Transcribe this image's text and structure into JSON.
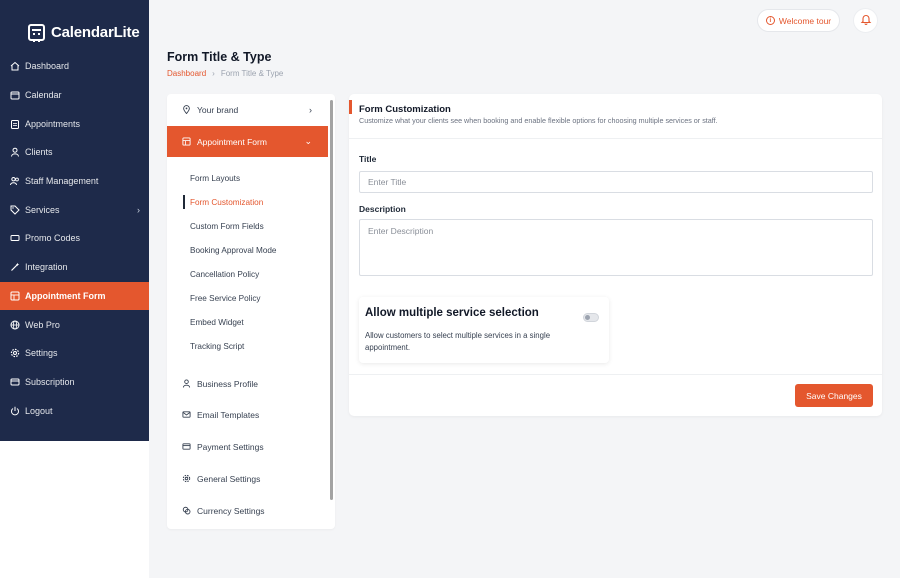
{
  "brand": {
    "name": "CalendarLite"
  },
  "sidebar": {
    "items": [
      {
        "label": "Dashboard",
        "icon": "home-icon"
      },
      {
        "label": "Calendar",
        "icon": "calendar-icon"
      },
      {
        "label": "Appointments",
        "icon": "clipboard-icon"
      },
      {
        "label": "Clients",
        "icon": "user-icon"
      },
      {
        "label": "Staff Management",
        "icon": "users-icon"
      },
      {
        "label": "Services",
        "icon": "tag-icon",
        "has_submenu": true
      },
      {
        "label": "Promo Codes",
        "icon": "ticket-icon"
      },
      {
        "label": "Integration",
        "icon": "wand-icon"
      },
      {
        "label": "Appointment Form",
        "icon": "form-icon",
        "active": true
      },
      {
        "label": "Web Pro",
        "icon": "globe-icon"
      },
      {
        "label": "Settings",
        "icon": "gear-icon"
      },
      {
        "label": "Subscription",
        "icon": "card-icon"
      },
      {
        "label": "Logout",
        "icon": "power-icon"
      }
    ]
  },
  "topbar": {
    "welcome_tour": "Welcome tour"
  },
  "page": {
    "title": "Form Title & Type",
    "breadcrumb": [
      "Dashboard",
      "Form Title & Type"
    ]
  },
  "settings_menu": {
    "your_brand": "Your brand",
    "appointment_form": "Appointment Form",
    "sub_items": [
      "Form Layouts",
      "Form Customization",
      "Custom Form Fields",
      "Booking Approval Mode",
      "Cancellation Policy",
      "Free Service Policy",
      "Embed Widget",
      "Tracking Script"
    ],
    "active_sub": "Form Customization",
    "others": [
      {
        "label": "Business Profile",
        "icon": "person-icon"
      },
      {
        "label": "Email Templates",
        "icon": "mail-icon"
      },
      {
        "label": "Payment Settings",
        "icon": "wallet-icon"
      },
      {
        "label": "General Settings",
        "icon": "settings-icon"
      },
      {
        "label": "Currency Settings",
        "icon": "coins-icon"
      }
    ]
  },
  "card": {
    "title": "Form Customization",
    "description": "Customize what your clients see when booking and enable flexible options for choosing multiple services or staff.",
    "title_label": "Title",
    "title_placeholder": "Enter Title",
    "description_label": "Description",
    "description_placeholder": "Enter Description",
    "option_title": "Allow multiple service selection",
    "option_desc": "Allow customers to select multiple services in a single appointment.",
    "option_enabled": false,
    "save_label": "Save Changes"
  },
  "colors": {
    "accent": "#e4572e",
    "sidebar_bg": "#1e2a4a"
  }
}
